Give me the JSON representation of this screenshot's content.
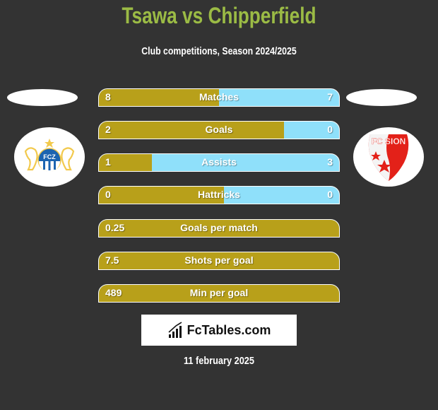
{
  "header": {
    "title": "Tsawa vs Chipperfield",
    "subtitle": "Club competitions, Season 2024/2025"
  },
  "teams": {
    "left": {
      "logo": "fc-zurich-logo",
      "abbr": "FCZ"
    },
    "right": {
      "logo": "fc-sion-logo",
      "abbr": "FC SION"
    }
  },
  "colors": {
    "left_bar": "#b8a01a",
    "right_bar": "#8fe0fa",
    "title": "#9bbb45",
    "background": "#333333"
  },
  "stats": [
    {
      "label": "Matches",
      "left": "8",
      "right": "7",
      "left_share": 0.5
    },
    {
      "label": "Goals",
      "left": "2",
      "right": "0",
      "left_share": 0.77
    },
    {
      "label": "Assists",
      "left": "1",
      "right": "3",
      "left_share": 0.22
    },
    {
      "label": "Hattricks",
      "left": "0",
      "right": "0",
      "left_share": 0.52
    },
    {
      "label": "Goals per match",
      "left": "0.25",
      "right": "",
      "left_share": 1.0
    },
    {
      "label": "Shots per goal",
      "left": "7.5",
      "right": "",
      "left_share": 1.0
    },
    {
      "label": "Min per goal",
      "left": "489",
      "right": "",
      "left_share": 1.0
    }
  ],
  "brand": {
    "icon": "bar-chart-icon",
    "text": "FcTables.com"
  },
  "date": "11 february 2025"
}
